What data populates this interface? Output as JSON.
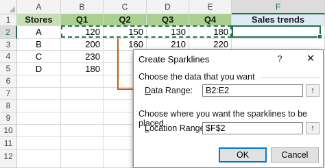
{
  "columns": [
    "A",
    "B",
    "C",
    "D",
    "E",
    "F"
  ],
  "rows": [
    "1",
    "2",
    "3",
    "4",
    "5",
    "6",
    "7",
    "8",
    "9",
    "10",
    "11",
    "12"
  ],
  "table": {
    "headers": [
      "Stores",
      "Q1",
      "Q2",
      "Q3",
      "Q4",
      "Sales trends"
    ],
    "data": [
      [
        "A",
        "120",
        "150",
        "130",
        "180",
        ""
      ],
      [
        "B",
        "200",
        "160",
        "210",
        "220",
        ""
      ],
      [
        "C",
        "230",
        "",
        "",
        "",
        ""
      ],
      [
        "D",
        "180",
        "",
        "",
        "",
        ""
      ]
    ]
  },
  "dialog": {
    "title": "Create Sparklines",
    "help": "?",
    "close": "✕",
    "section1": "Choose the data that you want",
    "data_range_label_prefix": "D",
    "data_range_label_rest": "ata Range:",
    "data_range_value": "B2:E2",
    "section2": "Choose where you want the sparklines to be placed",
    "location_range_label_prefix": "L",
    "location_range_label_rest": "ocation Range:",
    "location_range_value": "$F$2",
    "collapse_icon": "↑",
    "ok": "OK",
    "cancel": "Cancel"
  },
  "colors": {
    "green_selection": "#217346",
    "arrow": "#c55a11",
    "stores_header": "#c6e0b4",
    "quarter_header": "#a9d08e",
    "trends_header": "#ddebf7"
  }
}
